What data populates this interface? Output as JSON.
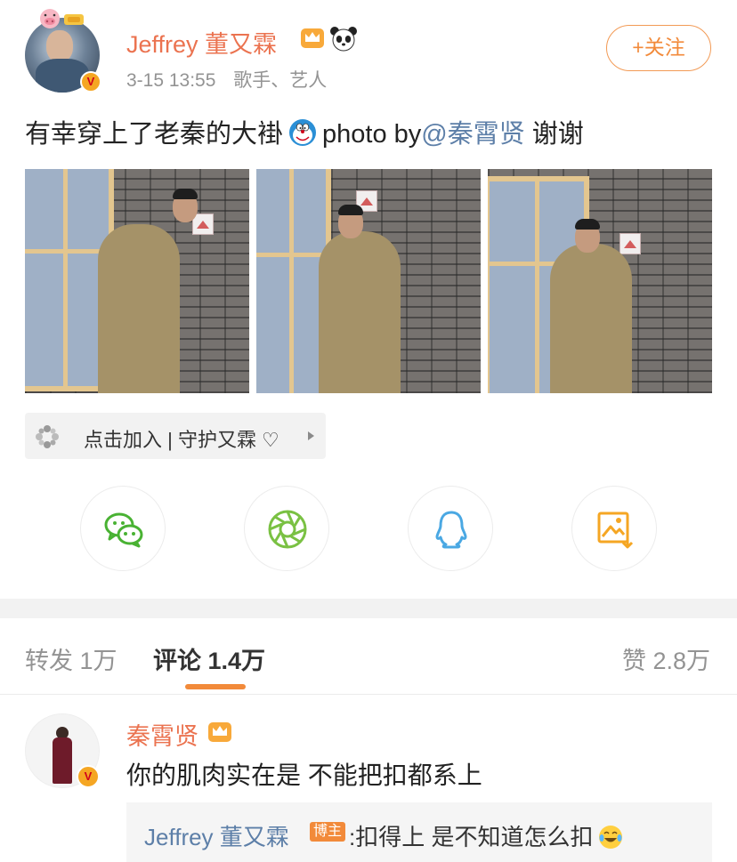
{
  "post": {
    "author": {
      "name": "Jeffrey 董又霖",
      "avatar_icon": "user-avatar",
      "badges": [
        "crown-icon",
        "panda-icon",
        "pig-icon",
        "verified-v-icon"
      ]
    },
    "timestamp": "3-15 13:55",
    "source": "歌手、艺人",
    "follow_label": "+关注",
    "text_prefix": "有幸穿上了老秦的大褂",
    "text_photo_by": "photo by",
    "text_mention": "@秦霄贤",
    "text_suffix": "谢谢",
    "emoji": "doraemon-icon",
    "images": [
      "photo-1",
      "photo-2",
      "photo-3"
    ]
  },
  "super_topic": {
    "label": "点击加入 | 守护又霖 ♡",
    "icon": "pinwheel-icon"
  },
  "share_buttons": [
    {
      "name": "wechat",
      "icon": "wechat-icon",
      "color": "#49b233"
    },
    {
      "name": "moments",
      "icon": "moments-icon",
      "color": "#7ac143"
    },
    {
      "name": "qq",
      "icon": "qq-icon",
      "color": "#4aa8e3"
    },
    {
      "name": "save-image",
      "icon": "save-image-icon",
      "color": "#f5a623"
    }
  ],
  "tabs": {
    "repost": "转发 1万",
    "comment": "评论 1.4万",
    "like": "赞 2.8万"
  },
  "comment": {
    "author": "秦霄贤",
    "text": "你的肌肉实在是  不能把扣都系上",
    "reply": {
      "author": "Jeffrey 董又霖",
      "tag": "博主",
      "text": ":扣得上 是不知道怎么扣",
      "emoji": "laughing-crying-icon"
    }
  },
  "colors": {
    "accent": "#f28a3a",
    "username": "#eb7350",
    "link": "#5d7fa8",
    "meta": "#939393"
  }
}
